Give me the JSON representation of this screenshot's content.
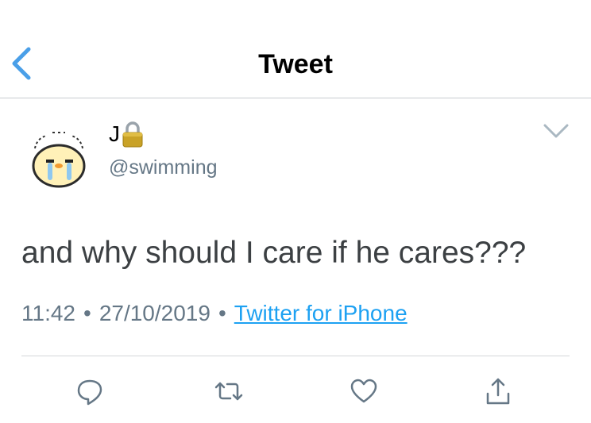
{
  "header": {
    "title": "Tweet"
  },
  "tweet": {
    "display_name": "J",
    "handle": "@swimming",
    "text": "and why should I care if he cares???",
    "time": "11:42",
    "separator": "•",
    "date": "27/10/2019",
    "source": "Twitter for iPhone"
  },
  "colors": {
    "accent": "#1da1f2",
    "secondary_text": "#657786",
    "action_icon": "#657786"
  },
  "icons": [
    "back-chevron-icon",
    "lock-icon",
    "chevron-down-icon",
    "reply-icon",
    "retweet-icon",
    "like-icon",
    "share-icon"
  ]
}
